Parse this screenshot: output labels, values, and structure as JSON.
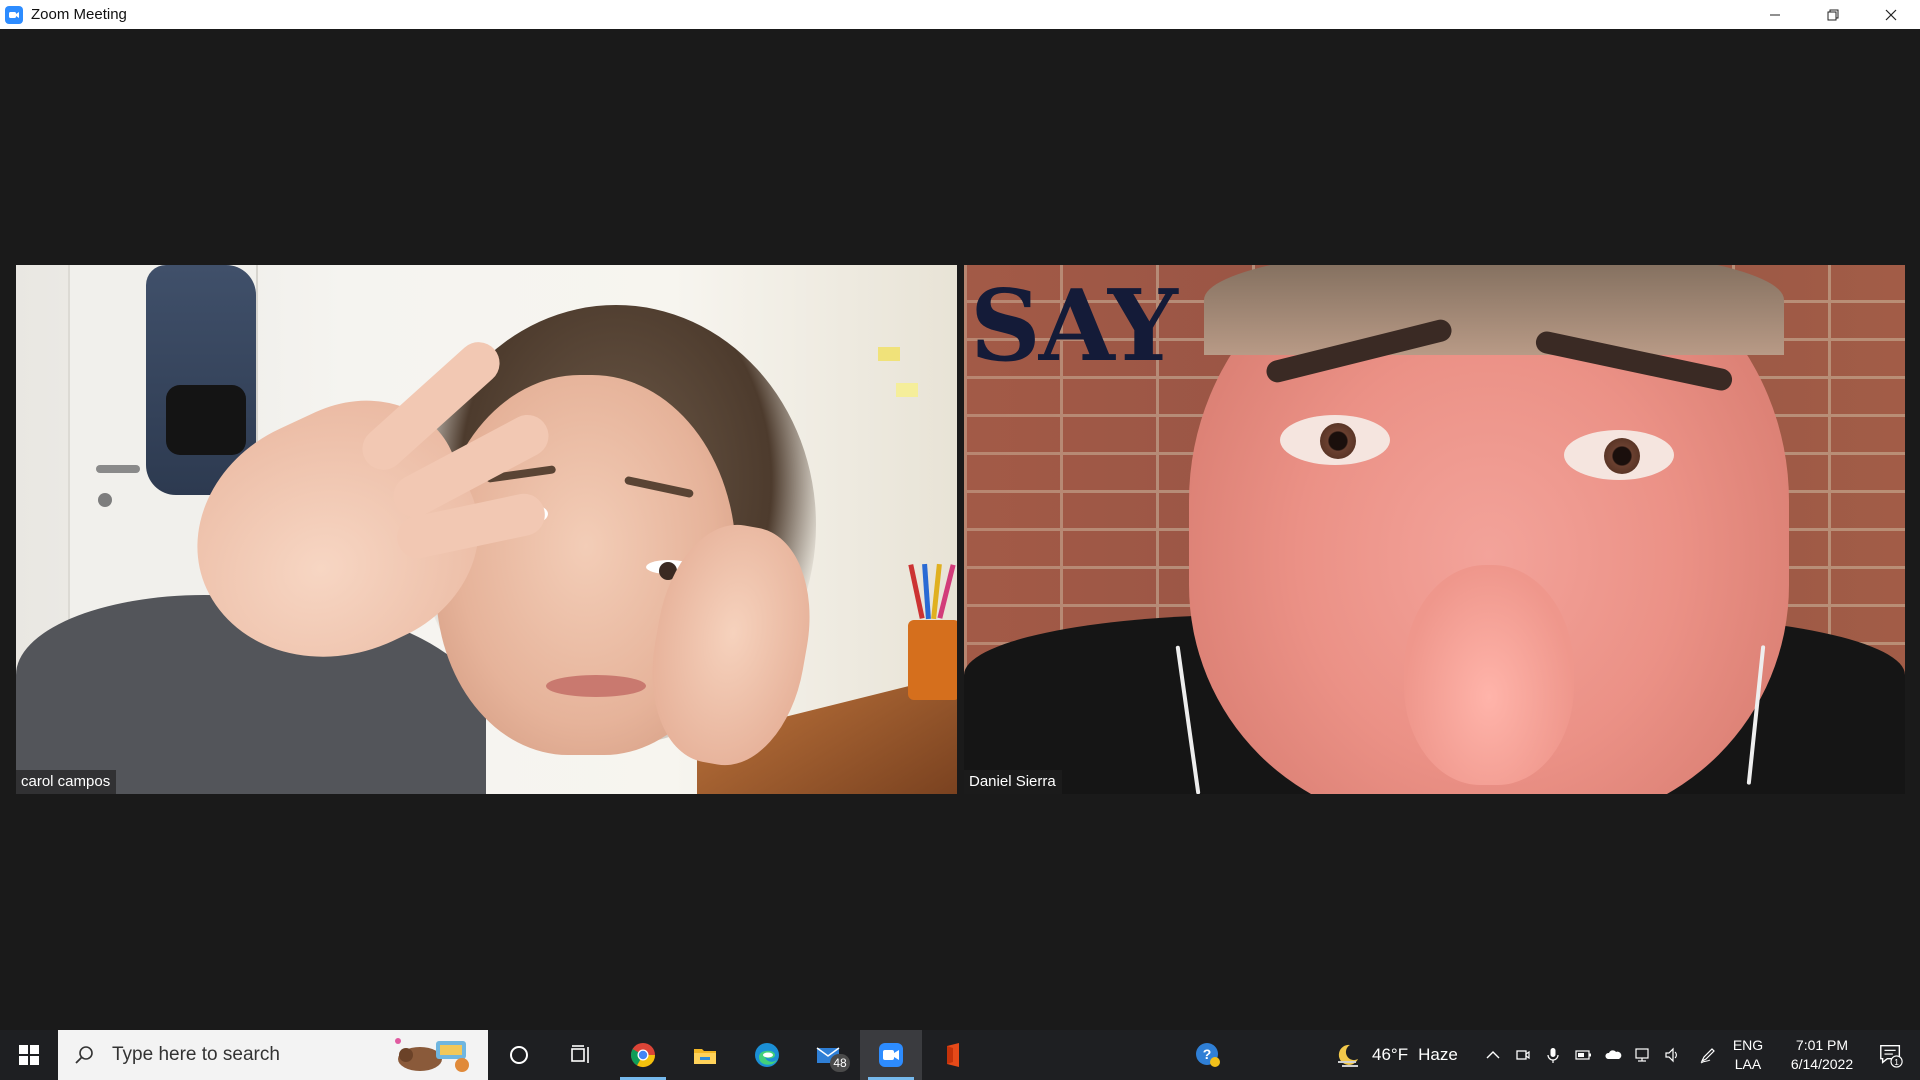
{
  "window": {
    "title": "Zoom Meeting",
    "controls": [
      "minimize",
      "restore",
      "close"
    ]
  },
  "meeting": {
    "participants": [
      {
        "name": "carol campos"
      },
      {
        "name": "Daniel Sierra"
      }
    ],
    "virtual_background_text": "SAY"
  },
  "taskbar": {
    "search_placeholder": "Type here to search",
    "pinned_apps": [
      {
        "name": "chrome-icon",
        "active": true
      },
      {
        "name": "file-explorer-icon",
        "active": false
      },
      {
        "name": "edge-icon",
        "active": false
      },
      {
        "name": "mail-icon",
        "badge": "48"
      },
      {
        "name": "zoom-icon",
        "active": true,
        "current": true
      },
      {
        "name": "office-icon",
        "active": false
      }
    ],
    "mail_badge": "48",
    "weather": {
      "temp": "46°F",
      "condition": "Haze"
    },
    "language": {
      "line1": "ENG",
      "line2": "LAA"
    },
    "clock": {
      "time": "7:01 PM",
      "date": "6/14/2022"
    },
    "notification_count": "1"
  },
  "colors": {
    "zoom_blue": "#2d8cff",
    "meeting_bg": "#1a1a1a",
    "taskbar_bg": "#1e1f22"
  }
}
